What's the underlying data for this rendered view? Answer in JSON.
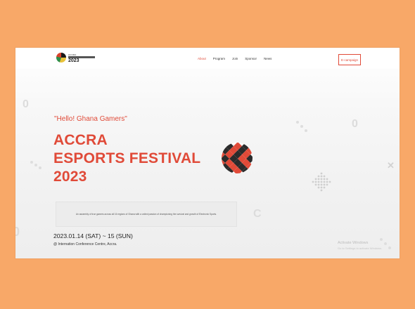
{
  "header": {
    "logo_alt": "Accra Esports Festival 2023",
    "logo_top_text": "ACCRA",
    "logo_year": "2023",
    "menu": [
      "About",
      "Program",
      "Join",
      "Sponsor",
      "News"
    ],
    "active_menu": "About",
    "campaign_label": "E-campaign"
  },
  "hero": {
    "greeting": "\"Hello! Ghana Gamers\"",
    "title_line1": "ACCRA",
    "title_line2": "ESPORTS FESTIVAL",
    "title_line3": "2023",
    "description": "An assembly of true gamers across all 16 regions of Ghana with a united passion of championing the survival and growth of Electronic Sports.",
    "date": "2023.01.14 (SAT) ~ 15 (SUN)",
    "venue": "@ Internation Conference Centre, Accra."
  },
  "os_watermark": {
    "line1": "Activate Windows",
    "line2": "Go to Settings to activate Windows."
  },
  "colors": {
    "accent": "#e04a38",
    "frame_bg": "#f8a868",
    "page_bg": "#f2f2f2"
  }
}
